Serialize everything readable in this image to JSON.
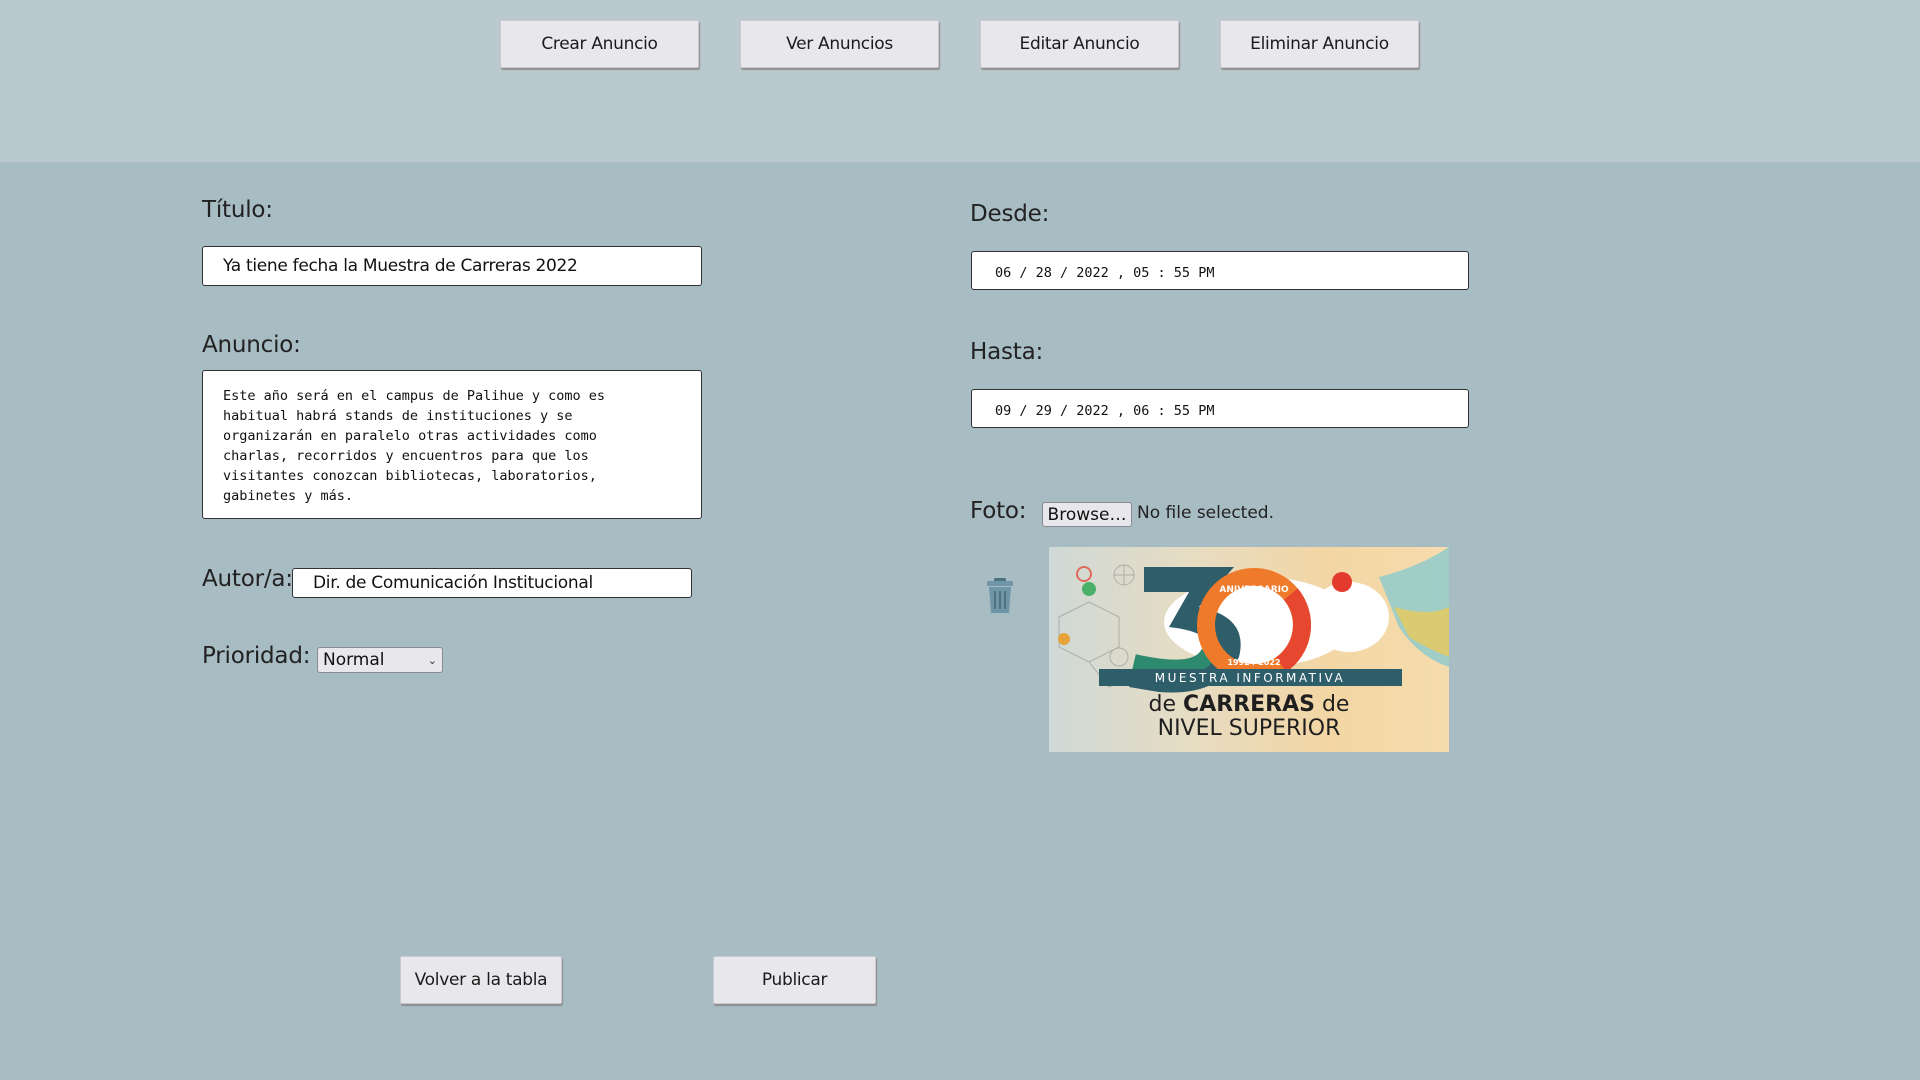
{
  "nav": {
    "buttons": [
      "Crear Anuncio",
      "Ver Anuncios",
      "Editar Anuncio",
      "Eliminar Anuncio"
    ]
  },
  "form": {
    "titulo_label": "Título:",
    "titulo_value": "Ya tiene fecha la Muestra de Carreras 2022",
    "anuncio_label": "Anuncio:",
    "anuncio_value": "Este año será en el campus de Palihue y como es\nhabitual habrá stands de instituciones y se\norganizarán en paralelo otras actividades como\ncharlas, recorridos y encuentros para que los\nvisitantes conozcan bibliotecas, laboratorios,\ngabinetes y más.",
    "autor_label": "Autor/a:",
    "autor_value": "Dir. de Comunicación Institucional",
    "prioridad_label": "Prioridad:",
    "prioridad_value": "Normal",
    "desde_label": "Desde:",
    "desde_value": "06 / 28 / 2022 ,  05 : 55  PM",
    "hasta_label": "Hasta:",
    "hasta_value": "09 / 29 / 2022 ,  06 : 55  PM",
    "foto_label": "Foto:",
    "browse_label": "Browse…",
    "file_status": "No file selected.",
    "photo": {
      "banner_line": "MUESTRA INFORMATIVA",
      "line2_pre": "de ",
      "line2_main": "CARRERAS",
      "line2_post": " de",
      "line3": "NIVEL SUPERIOR",
      "ring_text": "ANIVERSARIO",
      "years": "1992 / 2022"
    }
  },
  "actions": {
    "back_label": "Volver a la tabla",
    "publish_label": "Publicar"
  },
  "colors": {
    "header_bg": "#b9c9ce",
    "page_bg": "#a8bcc3",
    "button_bg": "#e8e8ec",
    "trash_icon": "#5f8494"
  }
}
